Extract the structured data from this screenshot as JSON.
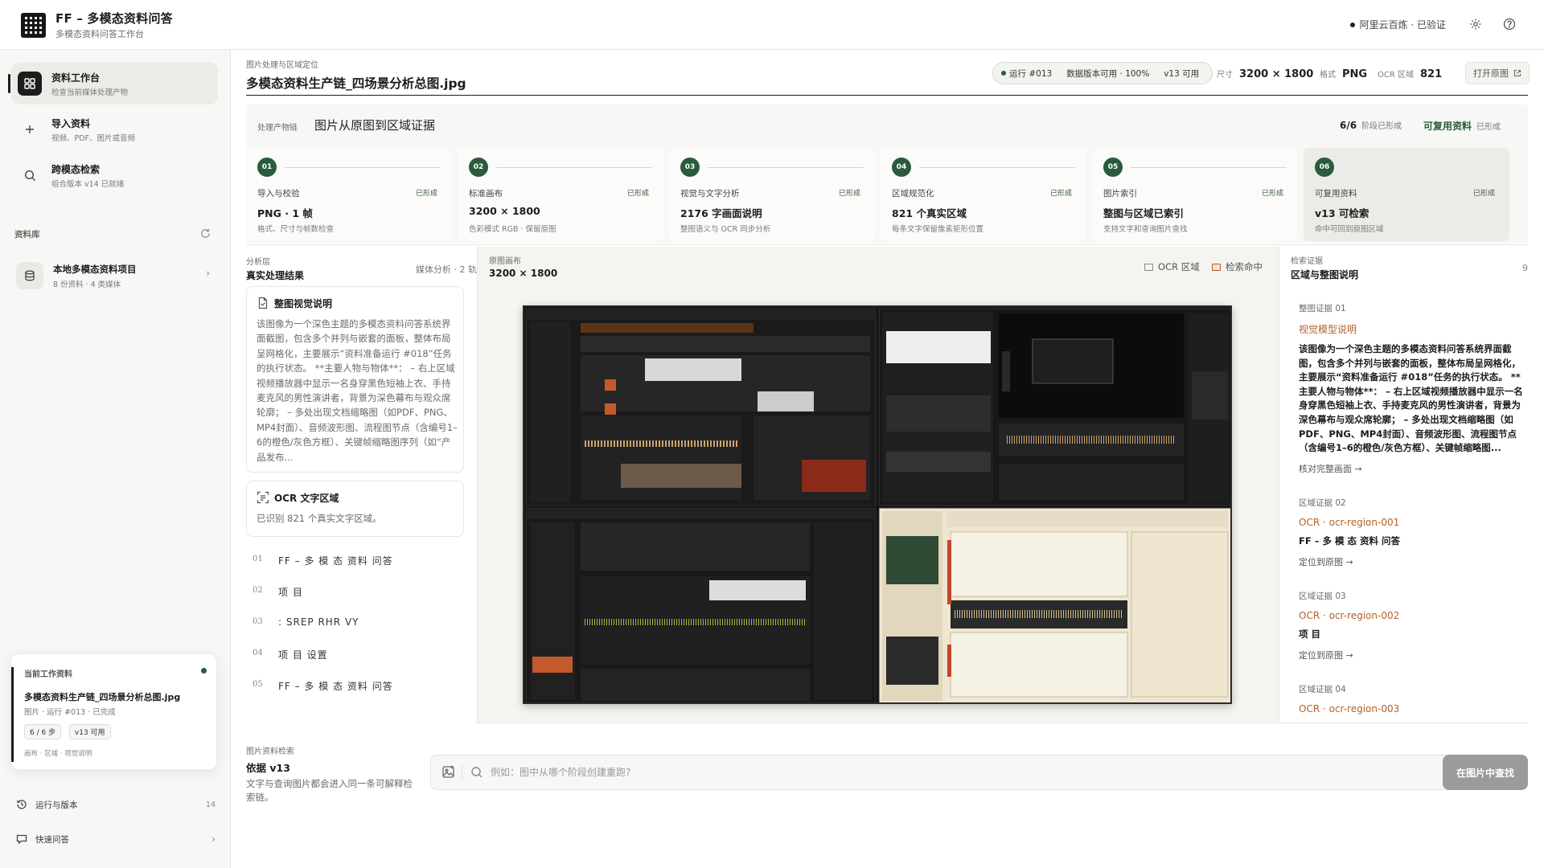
{
  "app": {
    "title": "FF – 多模态资料问答",
    "subtitle": "多模态资料问答工作台",
    "status": "阿里云百炼 · 已验证"
  },
  "sidebar": {
    "nav": [
      {
        "label": "资料工作台",
        "sub": "检查当前媒体处理产物",
        "icon": "grid-icon"
      },
      {
        "label": "导入资料",
        "sub": "视频、PDF、图片或音频",
        "icon": "plus-icon"
      },
      {
        "label": "跨模态检索",
        "sub": "组合版本 v14 已就绪",
        "icon": "search-icon"
      }
    ],
    "library_label": "资料库",
    "project": {
      "name": "本地多模态资料项目",
      "sub": "8 份资料 · 4 类媒体"
    },
    "current": {
      "label": "当前工作资料",
      "file": "多模态资料生产链_四场景分析总图.jpg",
      "meta": "图片 · 运行 #013 · 已完成",
      "chip1": "6 / 6 步",
      "chip2": "v13 可用",
      "tail": "画布 · 区域 · 视觉说明"
    },
    "runs": {
      "label": "运行与版本",
      "count": "14"
    },
    "quick": {
      "label": "快速问答"
    }
  },
  "header": {
    "crumb": "图片处理与区域定位",
    "file_title": "多模态资料生产链_四场景分析总图.jpg",
    "run": "运行 #013",
    "data_version": "数据版本可用 · 100%",
    "version": "v13 可用",
    "size_label": "尺寸",
    "size_value": "3200 × 1800",
    "format_label": "格式",
    "format_value": "PNG",
    "ocr_label": "OCR 区域",
    "ocr_value": "821",
    "open_label": "打开原图"
  },
  "pipeline": {
    "small": "处理产物链",
    "title": "图片从原图到区域证据",
    "progress": "6/6",
    "progress_note": "阶段已形成",
    "reusable": "可复用资料",
    "reusable_note": "已形成",
    "steps": [
      {
        "num": "01",
        "label": "导入与校验",
        "badge": "已形成",
        "value": "PNG · 1 帧",
        "desc": "格式、尺寸与帧数检查"
      },
      {
        "num": "02",
        "label": "标准画布",
        "badge": "已形成",
        "value": "3200 × 1800",
        "desc": "色彩模式 RGB · 保留原图"
      },
      {
        "num": "03",
        "label": "视觉与文字分析",
        "badge": "已形成",
        "value": "2176 字画面说明",
        "desc": "整图语义与 OCR 同步分析"
      },
      {
        "num": "04",
        "label": "区域规范化",
        "badge": "已形成",
        "value": "821 个真实区域",
        "desc": "每条文字保留像素矩形位置"
      },
      {
        "num": "05",
        "label": "图片索引",
        "badge": "已形成",
        "value": "整图与区域已索引",
        "desc": "支持文字和查询图片查找"
      },
      {
        "num": "06",
        "label": "可复用资料",
        "badge": "已形成",
        "value": "v13 可检索",
        "desc": "命中可回到原图区域"
      }
    ]
  },
  "analysis": {
    "small": "分析层",
    "title": "真实处理结果",
    "right": "媒体分析 · 2 轨",
    "visual_title": "整图视觉说明",
    "visual_body": "该图像为一个深色主题的多模态资料问答系统界面截图，包含多个并列与嵌套的面板，整体布局呈网格化，主要展示“资料准备运行 #018”任务的执行状态。 **主要人物与物体**： – 右上区域视频播放器中显示一名身穿黑色短袖上衣、手持麦克风的男性演讲者，背景为深色幕布与观众席轮廓； – 多处出现文档缩略图（如PDF、PNG、MP4封面）、音频波形图、流程图节点（含编号1–6的橙色/灰色方框）、关键帧缩略图序列（如“产品发布...",
    "ocr_title": "OCR 文字区域",
    "ocr_body": "已识别 821 个真实文字区域。",
    "ocr_rows": [
      {
        "idx": "01",
        "text": "FF – 多 模 态 资料 问答"
      },
      {
        "idx": "02",
        "text": "项 目"
      },
      {
        "idx": "03",
        "text": ": SREP RHR VY"
      },
      {
        "idx": "04",
        "text": "项 目 设置"
      },
      {
        "idx": "05",
        "text": "FF – 多 模 态 资料 问答"
      }
    ]
  },
  "canvas": {
    "small": "原图画布",
    "size": "3200 × 1800",
    "legend_ocr": "OCR 区域",
    "legend_hit": "检索命中"
  },
  "evidence": {
    "small": "检索证据",
    "title": "区域与整图说明",
    "count": "9",
    "items": [
      {
        "k": "整图证据 01",
        "t": "视觉模型说明",
        "b": "该图像为一个深色主题的多模态资料问答系统界面截图，包含多个并列与嵌套的面板，整体布局呈网格化，主要展示“资料准备运行 #018”任务的执行状态。 **主要人物与物体**： – 右上区域视频播放器中显示一名身穿黑色短袖上衣、手持麦克风的男性演讲者，背景为深色幕布与观众席轮廓； – 多处出现文档缩略图（如PDF、PNG、MP4封面）、音频波形图、流程图节点（含编号1–6的橙色/灰色方框）、关键帧缩略图...",
        "l": "核对完整画面"
      },
      {
        "k": "区域证据 02",
        "t": "OCR · ocr-region-001",
        "b": "FF – 多 模 态 资料 问答",
        "l": "定位到原图"
      },
      {
        "k": "区域证据 03",
        "t": "OCR · ocr-region-002",
        "b": "项 目",
        "l": "定位到原图"
      },
      {
        "k": "区域证据 04",
        "t": "OCR · ocr-region-003",
        "b": "",
        "l": ""
      }
    ]
  },
  "search": {
    "small": "图片资料检索",
    "title": "依据 v13",
    "desc": "文字与查询图片都会进入同一条可解释检索链。",
    "placeholder": "例如：图中从哪个阶段创建重跑?",
    "button": "在图片中查找"
  }
}
